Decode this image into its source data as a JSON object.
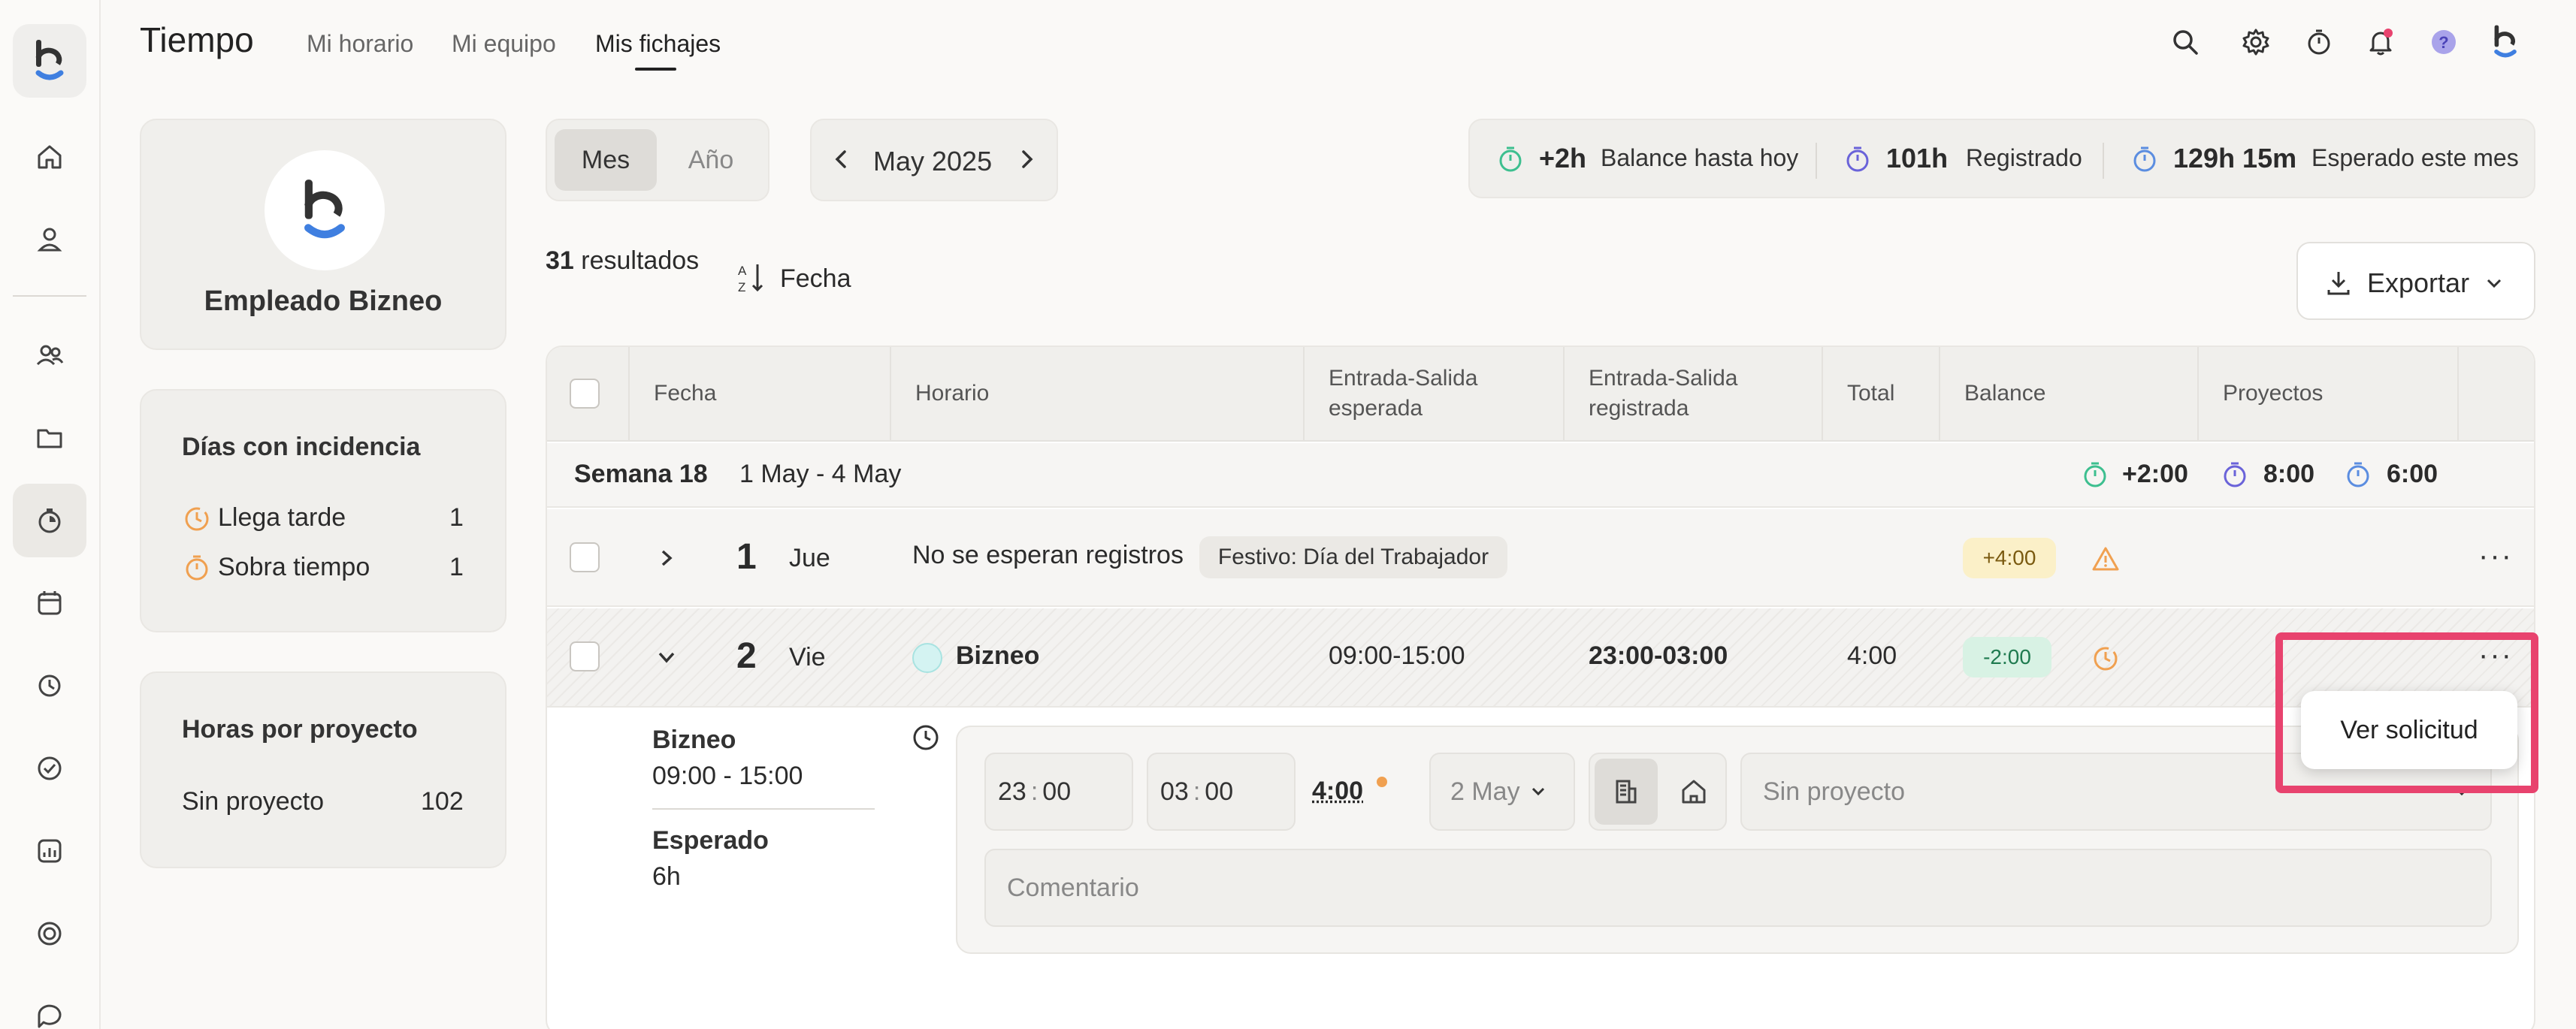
{
  "app": {
    "title": "Tiempo"
  },
  "nav": {
    "tabs": [
      "Mi horario",
      "Mi equipo",
      "Mis fichajes"
    ],
    "active": "Mis fichajes"
  },
  "profile": {
    "name": "Empleado Bizneo"
  },
  "incidents": {
    "title": "Días con incidencia",
    "items": [
      {
        "label": "Llega tarde",
        "count": "1"
      },
      {
        "label": "Sobra tiempo",
        "count": "1"
      }
    ]
  },
  "projects_card": {
    "title": "Horas por proyecto",
    "items": [
      {
        "label": "Sin proyecto",
        "hours": "102"
      }
    ]
  },
  "view_toggle": {
    "options": [
      "Mes",
      "Año"
    ],
    "selected": "Mes"
  },
  "period": {
    "label": "May 2025"
  },
  "stats": [
    {
      "value": "+2h",
      "label": "Balance hasta hoy"
    },
    {
      "value": "101h",
      "label": "Registrado"
    },
    {
      "value": "129h 15m",
      "label": "Esperado este mes"
    }
  ],
  "results": {
    "count": "31",
    "label": "resultados",
    "sort_label": "Fecha"
  },
  "export": {
    "label": "Exportar"
  },
  "table": {
    "headers": {
      "fecha": "Fecha",
      "horario": "Horario",
      "esperada_1": "Entrada-Salida",
      "esperada_2": "esperada",
      "registrada_1": "Entrada-Salida",
      "registrada_2": "registrada",
      "total": "Total",
      "balance": "Balance",
      "proyectos": "Proyectos"
    },
    "week": {
      "label": "Semana 18",
      "range": "1 May - 4 May",
      "balance": "+2:00",
      "registered": "8:00",
      "expected": "6:00"
    },
    "rows": [
      {
        "day": "1",
        "weekday": "Jue",
        "text": "No se esperan registros",
        "holiday": "Festivo: Día del Trabajador",
        "balance": "+4:00"
      },
      {
        "day": "2",
        "weekday": "Vie",
        "schedule": "Bizneo",
        "expected": "09:00-15:00",
        "registered": "23:00-03:00",
        "total": "4:00",
        "balance": "-2:00"
      }
    ],
    "detail": {
      "schedule_name": "Bizneo",
      "schedule_hours": "09:00 - 15:00",
      "expected_label": "Esperado",
      "expected_value": "6h",
      "in_h": "23",
      "in_m": "00",
      "out_h": "03",
      "out_m": "00",
      "total": "4:00",
      "date": "2 May",
      "project_placeholder": "Sin proyecto",
      "comment_placeholder": "Comentario"
    }
  },
  "menu": {
    "item": "Ver solicitud"
  },
  "colors": {
    "accent": "#e8436e",
    "green": "#3dbf8f",
    "purple": "#6a63d9",
    "blue": "#5b8de0",
    "orange": "#f0a050",
    "positive_bg": "#fbf0c8",
    "negative_bg": "#d8f2e4"
  }
}
